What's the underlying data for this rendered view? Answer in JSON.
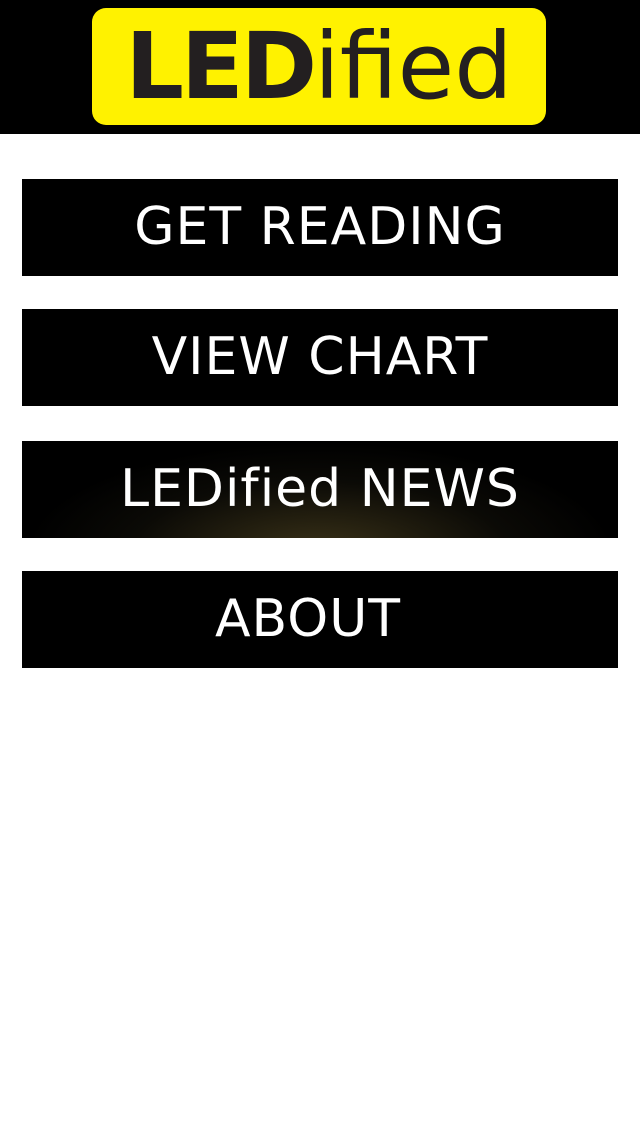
{
  "logo": {
    "bold_part": "LED",
    "light_part": "ified"
  },
  "menu": {
    "get_reading": "GET READING",
    "view_chart": "VIEW CHART",
    "news": "LEDified NEWS",
    "about": "ABOUT"
  },
  "colors": {
    "header_background": "#000000",
    "logo_background": "#fff200",
    "logo_text": "#231f20",
    "button_background": "#000000",
    "button_text": "#ffffff",
    "page_background": "#ffffff"
  }
}
